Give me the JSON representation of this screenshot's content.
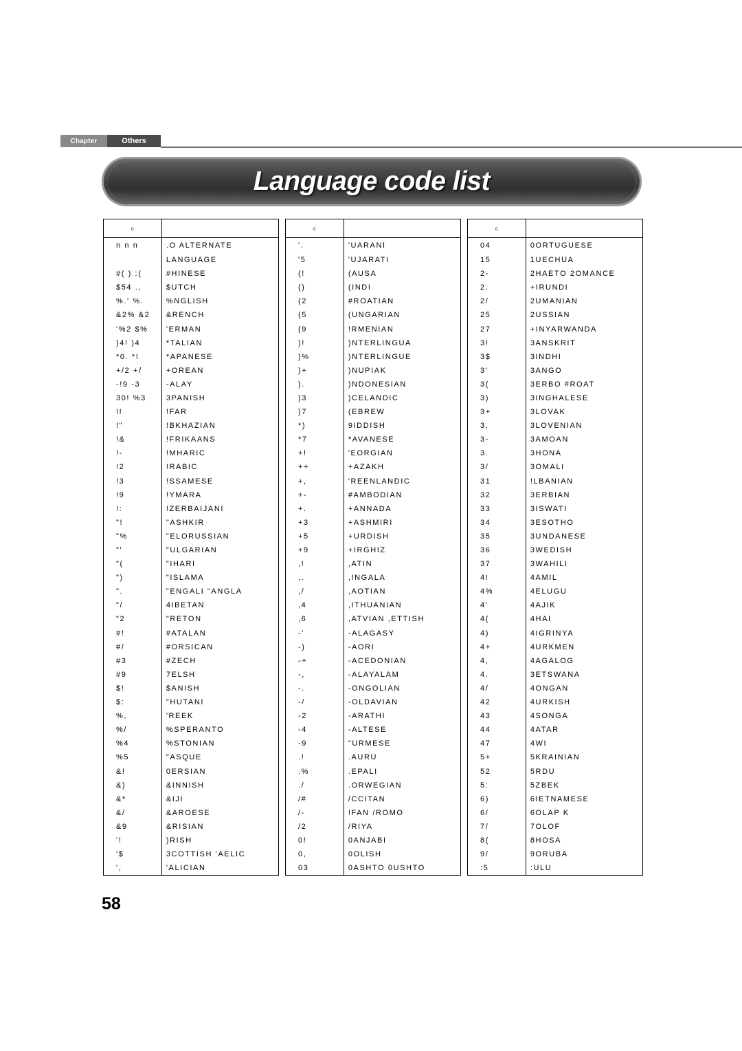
{
  "chapter": {
    "label": "Chapter",
    "name": "Others"
  },
  "title": "Language code list",
  "page_number": "58",
  "tables": [
    {
      "headers": {
        "code": "c",
        "name": ""
      },
      "rows": [
        [
          "n n n",
          ".O ALTERNATE"
        ],
        [
          "",
          "LANGUAGE"
        ],
        [
          "#( ) :(",
          "#HINESE"
        ],
        [
          "$54 .,",
          "$UTCH"
        ],
        [
          "%.' %.",
          "%NGLISH"
        ],
        [
          "&2% &2",
          "&RENCH"
        ],
        [
          "'%2 $%",
          "'ERMAN"
        ],
        [
          ")4! )4",
          "*TALIAN"
        ],
        [
          "*0. *!",
          "*APANESE"
        ],
        [
          "+/2 +/",
          "+OREAN"
        ],
        [
          "-!9 -3",
          "-ALAY"
        ],
        [
          "30! %3",
          "3PANISH"
        ],
        [
          "!!",
          "!FAR"
        ],
        [
          "!\"",
          "!BKHAZIAN"
        ],
        [
          "!&",
          "!FRIKAANS"
        ],
        [
          "!-",
          "!MHARIC"
        ],
        [
          "!2",
          "!RABIC"
        ],
        [
          "!3",
          "!SSAMESE"
        ],
        [
          "!9",
          "!YMARA"
        ],
        [
          "!:",
          "!ZERBAIJANI"
        ],
        [
          "\"!",
          "\"ASHKIR"
        ],
        [
          "\"%",
          "\"ELORUSSIAN"
        ],
        [
          "\"'",
          "\"ULGARIAN"
        ],
        [
          "\"(",
          "\"IHARI"
        ],
        [
          "\")",
          "\"ISLAMA"
        ],
        [
          "\".",
          "\"ENGALI \"ANGLA"
        ],
        [
          "\"/",
          "4IBETAN"
        ],
        [
          "\"2",
          "\"RETON"
        ],
        [
          "#!",
          "#ATALAN"
        ],
        [
          "#/",
          "#ORSICAN"
        ],
        [
          "#3",
          "#ZECH"
        ],
        [
          "#9",
          "7ELSH"
        ],
        [
          "$!",
          "$ANISH"
        ],
        [
          "$:",
          "\"HUTANI"
        ],
        [
          "%,",
          "'REEK"
        ],
        [
          "%/",
          "%SPERANTO"
        ],
        [
          "%4",
          "%STONIAN"
        ],
        [
          "%5",
          "\"ASQUE"
        ],
        [
          "&!",
          "0ERSIAN"
        ],
        [
          "&)",
          "&INNISH"
        ],
        [
          "&*",
          "&IJI"
        ],
        [
          "&/",
          "&AROESE"
        ],
        [
          "&9",
          "&RISIAN"
        ],
        [
          "'!",
          ")RISH"
        ],
        [
          "'$",
          "3COTTISH 'AELIC"
        ],
        [
          "',",
          "'ALICIAN"
        ]
      ]
    },
    {
      "headers": {
        "code": "c",
        "name": ""
      },
      "rows": [
        [
          "'.",
          "'UARANI"
        ],
        [
          "'5",
          "'UJARATI"
        ],
        [
          "(!",
          "(AUSA"
        ],
        [
          "()",
          "(INDI"
        ],
        [
          "(2",
          "#ROATIAN"
        ],
        [
          "(5",
          "(UNGARIAN"
        ],
        [
          "(9",
          "!RMENIAN"
        ],
        [
          ")!",
          ")NTERLINGUA"
        ],
        [
          ")%",
          ")NTERLINGUE"
        ],
        [
          ")+",
          ")NUPIAK"
        ],
        [
          ").",
          ")NDONESIAN"
        ],
        [
          ")3",
          ")CELANDIC"
        ],
        [
          ")7",
          "(EBREW"
        ],
        [
          "*)",
          "9IDDISH"
        ],
        [
          "*7",
          "*AVANESE"
        ],
        [
          "+!",
          "'EORGIAN"
        ],
        [
          "++",
          "+AZAKH"
        ],
        [
          "+,",
          "'REENLANDIC"
        ],
        [
          "+-",
          "#AMBODIAN"
        ],
        [
          "+.",
          "+ANNADA"
        ],
        [
          "+3",
          "+ASHMIRI"
        ],
        [
          "+5",
          "+URDISH"
        ],
        [
          "+9",
          "+IRGHIZ"
        ],
        [
          ",!",
          ",ATIN"
        ],
        [
          ",.",
          ",INGALA"
        ],
        [
          ",/",
          ",AOTIAN"
        ],
        [
          ",4",
          ",ITHUANIAN"
        ],
        [
          ",6",
          ",ATVIAN ,ETTISH"
        ],
        [
          "-'",
          "-ALAGASY"
        ],
        [
          "-)",
          "-AORI"
        ],
        [
          "-+",
          "-ACEDONIAN"
        ],
        [
          "-,",
          "-ALAYALAM"
        ],
        [
          "-.",
          "-ONGOLIAN"
        ],
        [
          "-/",
          "-OLDAVIAN"
        ],
        [
          "-2",
          "-ARATHI"
        ],
        [
          "-4",
          "-ALTESE"
        ],
        [
          "-9",
          "\"URMESE"
        ],
        [
          ".!",
          ".AURU"
        ],
        [
          ".%",
          ".EPALI"
        ],
        [
          "./",
          ".ORWEGIAN"
        ],
        [
          "/#",
          "/CCITAN"
        ],
        [
          "/-",
          "!FAN /ROMO"
        ],
        [
          "/2",
          "/RIYA"
        ],
        [
          "0!",
          "0ANJABI"
        ],
        [
          "0,",
          "0OLISH"
        ],
        [
          "03",
          "0ASHTO 0USHTO"
        ]
      ]
    },
    {
      "headers": {
        "code": "c",
        "name": ""
      },
      "rows": [
        [
          "04",
          "0ORTUGUESE"
        ],
        [
          "15",
          "1UECHUA"
        ],
        [
          "2-",
          "2HAETO 2OMANCE"
        ],
        [
          "2.",
          "+IRUNDI"
        ],
        [
          "2/",
          "2UMANIAN"
        ],
        [
          "25",
          "2USSIAN"
        ],
        [
          "27",
          "+INYARWANDA"
        ],
        [
          "3!",
          "3ANSKRIT"
        ],
        [
          "3$",
          "3INDHI"
        ],
        [
          "3'",
          "3ANGO"
        ],
        [
          "3(",
          "3ERBO #ROAT"
        ],
        [
          "3)",
          "3INGHALESE"
        ],
        [
          "3+",
          "3LOVAK"
        ],
        [
          "3,",
          "3LOVENIAN"
        ],
        [
          "3-",
          "3AMOAN"
        ],
        [
          "3.",
          "3HONA"
        ],
        [
          "3/",
          "3OMALI"
        ],
        [
          "31",
          "!LBANIAN"
        ],
        [
          "32",
          "3ERBIAN"
        ],
        [
          "33",
          "3ISWATI"
        ],
        [
          "34",
          "3ESOTHO"
        ],
        [
          "35",
          "3UNDANESE"
        ],
        [
          "36",
          "3WEDISH"
        ],
        [
          "37",
          "3WAHILI"
        ],
        [
          "4!",
          "4AMIL"
        ],
        [
          "4%",
          "4ELUGU"
        ],
        [
          "4'",
          "4AJIK"
        ],
        [
          "4(",
          "4HAI"
        ],
        [
          "4)",
          "4IGRINYA"
        ],
        [
          "4+",
          "4URKMEN"
        ],
        [
          "4,",
          "4AGALOG"
        ],
        [
          "4.",
          "3ETSWANA"
        ],
        [
          "4/",
          "4ONGAN"
        ],
        [
          "42",
          "4URKISH"
        ],
        [
          "43",
          "4SONGA"
        ],
        [
          "44",
          "4ATAR"
        ],
        [
          "47",
          "4WI"
        ],
        [
          "5+",
          "5KRAINIAN"
        ],
        [
          "52",
          "5RDU"
        ],
        [
          "5:",
          "5ZBEK"
        ],
        [
          "6)",
          "6IETNAMESE"
        ],
        [
          "6/",
          "6OLAP K"
        ],
        [
          "7/",
          "7OLOF"
        ],
        [
          "8(",
          "8HOSA"
        ],
        [
          "9/",
          "9ORUBA"
        ],
        [
          ":5",
          ":ULU"
        ]
      ]
    }
  ]
}
